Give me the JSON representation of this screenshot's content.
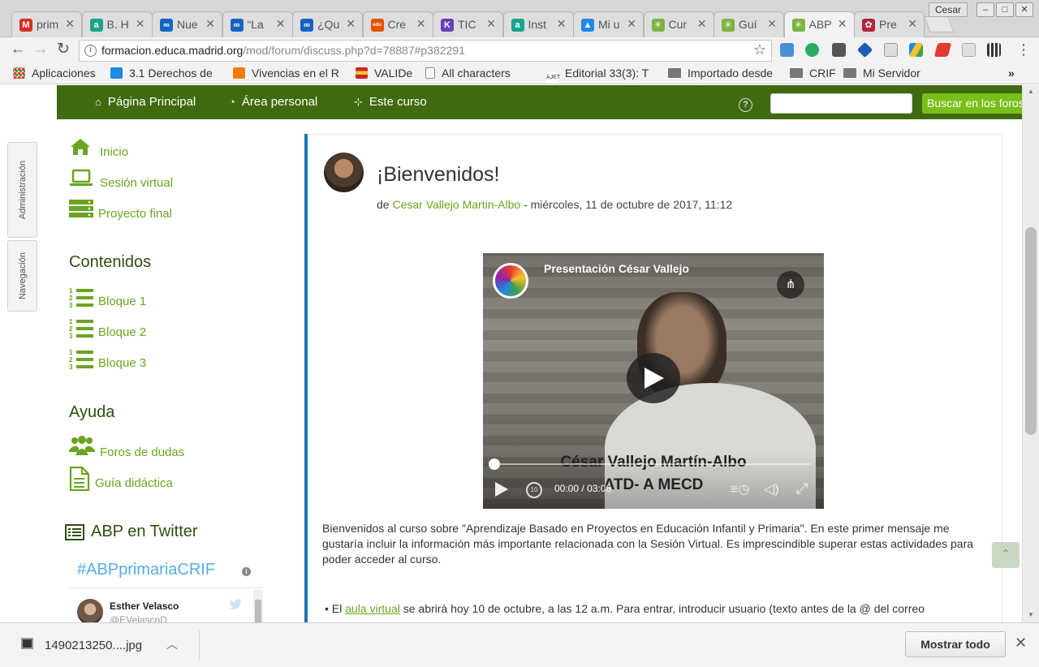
{
  "browser": {
    "tabs": [
      {
        "title": "prim",
        "favicon_color": "#d93025",
        "favicon_char": "M",
        "active": false
      },
      {
        "title": "B. H",
        "favicon_color": "#1aa38b",
        "favicon_char": "a",
        "active": false
      },
      {
        "title": "Nue",
        "favicon_color": "#1565c0",
        "favicon_char": "∞",
        "active": false
      },
      {
        "title": "“La",
        "favicon_color": "#1565c0",
        "favicon_char": "∞",
        "active": false
      },
      {
        "title": "¿Qu",
        "favicon_color": "#1565c0",
        "favicon_char": "∞",
        "active": false
      },
      {
        "title": "Cre",
        "favicon_color": "#e65100",
        "favicon_char": "edu",
        "active": false
      },
      {
        "title": "TIC",
        "favicon_color": "#6a3fb5",
        "favicon_char": "K",
        "active": false
      },
      {
        "title": "Inst",
        "favicon_color": "#1aa38b",
        "favicon_char": "a",
        "active": false
      },
      {
        "title": "Mi u",
        "favicon_color": "#1e88e5",
        "favicon_char": "▲",
        "active": false
      },
      {
        "title": "Cur",
        "favicon_color": "#7cb342",
        "favicon_char": "✳",
        "active": false
      },
      {
        "title": "Guí",
        "favicon_color": "#7cb342",
        "favicon_char": "✳",
        "active": false
      },
      {
        "title": "ABP",
        "favicon_color": "#7cb342",
        "favicon_char": "✳",
        "active": true
      },
      {
        "title": "Pre",
        "favicon_color": "#b0273a",
        "favicon_char": "✿",
        "active": false
      }
    ],
    "user_chip": "Cesar",
    "url_host": "formacion.educa.madrid.org",
    "url_path": "/mod/forum/discuss.php?d=78887#p382291",
    "bookmarks": [
      {
        "label": "Aplicaciones",
        "icon": "apps-grid-icon",
        "color": "#e53935"
      },
      {
        "label": "3.1 Derechos de",
        "icon": "ebay-icon",
        "color": "#1e88e5"
      },
      {
        "label": "Vivencias en el R",
        "icon": "blogger-icon",
        "color": "#f57c00"
      },
      {
        "label": "VALIDe",
        "icon": "spain-shield-icon",
        "color": "#c62828"
      },
      {
        "label": "All characters",
        "icon": "page-icon",
        "color": "#9e9e9e"
      },
      {
        "label": "Editorial 33(3): T",
        "icon": "ajet-icon",
        "color": "#555555"
      },
      {
        "label": "Importado desde",
        "icon": "folder-icon",
        "color": "#777777"
      },
      {
        "label": "CRIF",
        "icon": "folder-icon",
        "color": "#777777"
      },
      {
        "label": "Mi Servidor",
        "icon": "folder-icon",
        "color": "#777777"
      }
    ]
  },
  "site": {
    "nav": [
      {
        "label": "Página Principal",
        "icon": "home-icon"
      },
      {
        "label": "Área personal",
        "icon": "dashboard-icon"
      },
      {
        "label": "Este curso",
        "icon": "sitemap-icon"
      }
    ],
    "search_button": "Buscar en los foros",
    "side_tabs": [
      "Administración",
      "Navegación"
    ],
    "menu_top": [
      {
        "label": "Inicio",
        "icon": "home-icon"
      },
      {
        "label": "Sesión virtual",
        "icon": "laptop-icon"
      },
      {
        "label": "Proyecto final",
        "icon": "server-icon"
      }
    ],
    "contents_heading": "Contenidos",
    "blocks": [
      {
        "label": "Bloque 1"
      },
      {
        "label": "Bloque 2"
      },
      {
        "label": "Bloque 3"
      }
    ],
    "help_heading": "Ayuda",
    "help_items": [
      {
        "label": "Foros de dudas",
        "icon": "users-icon"
      },
      {
        "label": "Guía didáctica",
        "icon": "document-icon"
      }
    ],
    "twitter_heading": "ABP en Twitter",
    "twitter": {
      "hashtag": "#ABPprimariaCRIF",
      "user_name": "Esther Velasco",
      "user_handle": "@EVelascoD"
    },
    "accent_color": "#6aa51f",
    "navbar_color": "#3f6a0f"
  },
  "post": {
    "title": "¡Bienvenidos!",
    "meta_prefix": "de",
    "author": "Cesar Vallejo Martin-Albo",
    "date": "- miércoles, 11 de octubre de 2017, 11:12",
    "video": {
      "title": "Presentación César Vallejo",
      "caption_line1": "César Vallejo Martín-Albo",
      "caption_line2": "ATD- A MECD",
      "time_current": "00:00",
      "time_separator": "/",
      "time_total": "03:06",
      "progress": 0
    },
    "body": "Bienvenidos al curso sobre \"Aprendizaje Basado en Proyectos en Educación Infantil y Primaria\". En este primer mensaje me gustaría incluir la información más importante relacionada con la Sesión Virtual. Es imprescindible superar estas actividades para poder acceder al curso.",
    "bullet_prefix": "El",
    "bullet_link": "aula virtual",
    "bullet_text": "se abrirá hoy 10 de octubre, a las 12 a.m. Para entrar, introducir usuario (texto antes de la @ del correo"
  },
  "downloads": {
    "file_name": "1490213250....jpg",
    "show_all": "Mostrar todo"
  }
}
